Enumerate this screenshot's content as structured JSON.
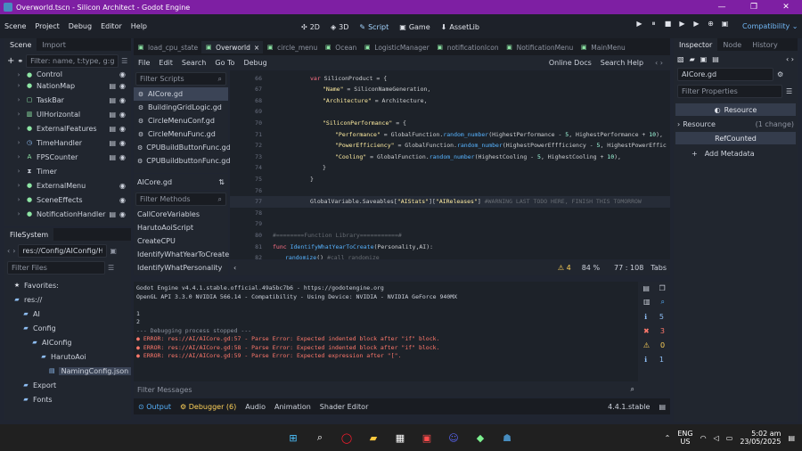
{
  "title": {
    "text": "Overworld.tscn - Silicon Architect - Godot Engine",
    "controls": [
      "—",
      "❐",
      "✕"
    ]
  },
  "menu": [
    "Scene",
    "Project",
    "Debug",
    "Editor",
    "Help"
  ],
  "workspaces": [
    {
      "icon": "✣",
      "label": "2D"
    },
    {
      "icon": "◈",
      "label": "3D"
    },
    {
      "icon": "✎",
      "label": "Script"
    },
    {
      "icon": "▣",
      "label": "Game"
    },
    {
      "icon": "⬇",
      "label": "AssetLib"
    }
  ],
  "play_icons": [
    "▶",
    "⏸",
    "■",
    "▶",
    "▶",
    "⊕",
    "▣"
  ],
  "renderer": "Compatibility ⌄",
  "scene_tabs": [
    "Scene",
    "Import"
  ],
  "scene_filter_placeholder": "Filter: name, t:type, g:gr",
  "scene_nodes": [
    {
      "label": "Control",
      "icon": "●",
      "color": "c-green",
      "vis": true,
      "script": false,
      "cut": true
    },
    {
      "label": "NationMap",
      "icon": "●",
      "color": "c-green",
      "vis": true,
      "script": true
    },
    {
      "label": "TaskBar",
      "icon": "▢",
      "color": "c-green",
      "vis": true,
      "script": true
    },
    {
      "label": "UIHorizontal",
      "icon": "▥",
      "color": "c-green",
      "vis": true,
      "script": true
    },
    {
      "label": "ExternalFeatures",
      "icon": "●",
      "color": "c-green",
      "vis": true,
      "script": true
    },
    {
      "label": "TimeHandler",
      "icon": "◷",
      "color": "c-blue",
      "vis": true,
      "script": true
    },
    {
      "label": "FPSCounter",
      "icon": "A",
      "color": "c-green",
      "vis": true,
      "script": true
    },
    {
      "label": "Timer",
      "icon": "⧗",
      "color": "",
      "vis": false,
      "script": false
    },
    {
      "label": "ExternalMenu",
      "icon": "●",
      "color": "c-green",
      "vis": true,
      "script": false
    },
    {
      "label": "SceneEffects",
      "icon": "●",
      "color": "c-green",
      "vis": true,
      "script": false
    },
    {
      "label": "NotificationHandler",
      "icon": "●",
      "color": "c-green",
      "vis": true,
      "script": true
    }
  ],
  "filesystem": {
    "tab": "FileSystem",
    "path": "res://Config/AIConfig/Haru",
    "filter_placeholder": "Filter Files",
    "items": [
      {
        "label": "Favorites:",
        "icon": "★",
        "indent": 0
      },
      {
        "label": "res://",
        "icon": "▰",
        "indent": 0
      },
      {
        "label": "AI",
        "icon": "▰",
        "indent": 1
      },
      {
        "label": "Config",
        "icon": "▰",
        "indent": 1
      },
      {
        "label": "AIConfig",
        "icon": "▰",
        "indent": 2
      },
      {
        "label": "HarutoAoi",
        "icon": "▰",
        "indent": 3
      },
      {
        "label": "NamingConfig.json",
        "icon": "▤",
        "indent": 4,
        "sel": true
      },
      {
        "label": "Export",
        "icon": "▰",
        "indent": 1
      },
      {
        "label": "Fonts",
        "icon": "▰",
        "indent": 1
      }
    ]
  },
  "script_tabs": [
    "load_cpu_state",
    "Overworld",
    "circle_menu",
    "Ocean",
    "LogisticManager",
    "notificationIcon",
    "NotificationMenu",
    "MainMenu"
  ],
  "script_menu": [
    "File",
    "Edit",
    "Search",
    "Go To",
    "Debug"
  ],
  "online_docs": "Online Docs",
  "search_help": "Search Help",
  "filter_scripts_placeholder": "Filter Scripts",
  "scripts": [
    {
      "label": "AICore.gd",
      "sel": true
    },
    {
      "label": "BuildingGridLogic.gd"
    },
    {
      "label": "CircleMenuConf.gd"
    },
    {
      "label": "CircleMenuFunc.gd"
    },
    {
      "label": "CPUBuildButtonFunc.gd"
    },
    {
      "label": "CPUBuildbuttonFunc.gd"
    }
  ],
  "current_script": "AICore.gd",
  "filter_methods_placeholder": "Filter Methods",
  "methods": [
    "CallCoreVariables",
    "HarutoAoiScript",
    "CreateCPU",
    "IdentifyWhatYearToCreate",
    "IdentifyWhatPersonality"
  ],
  "code": [
    {
      "n": "66",
      "t": "var SiliconProduct = {"
    },
    {
      "n": "67",
      "t": "\"Name\" = SiliconNameGeneration,"
    },
    {
      "n": "68",
      "t": "\"Architecture\" = Architecture,"
    },
    {
      "n": "69",
      "t": ""
    },
    {
      "n": "70",
      "t": "\"SiliconPerformance\" = {"
    },
    {
      "n": "71",
      "t": "\"Performance\" = GlobalFunction.random_number(HighestPerformance - 5, HighestPerformance + 10),"
    },
    {
      "n": "72",
      "t": "\"PowerEfficiency\" = GlobalFunction.random_number(HighestPowerEffficiency - 5, HighestPowerEffic"
    },
    {
      "n": "73",
      "t": "\"Cooling\" = GlobalFunction.random_number(HighestCooling - 5, HighestCooling + 10),"
    },
    {
      "n": "74",
      "t": "}"
    },
    {
      "n": "75",
      "t": "}"
    },
    {
      "n": "76",
      "t": ""
    },
    {
      "n": "77",
      "t": "GlobalVariable.Saveables[\"AIStats\"][\"AIReleases\"] #WARNING LAST TODO HERE, FINISH THIS TOMORROW"
    },
    {
      "n": "78",
      "t": ""
    },
    {
      "n": "79",
      "t": ""
    },
    {
      "n": "80",
      "t": "#========Function Library===========#"
    },
    {
      "n": "81",
      "t": "func IdentifyWhatYearToCreate(Personality,AI):"
    },
    {
      "n": "82",
      "t": "randomize() #call randomize"
    }
  ],
  "status": {
    "warnings": "⚠ 4",
    "zoom": "84 %",
    "position": "77 : 108",
    "indent": "Tabs"
  },
  "output": [
    "Godot Engine v4.4.1.stable.official.49a5bc7b6 - https://godotengine.org",
    "OpenGL API 3.3.0 NVIDIA 566.14 - Compatibility - Using Device: NVIDIA - NVIDIA GeForce 940MX",
    "",
    "1",
    "2",
    "--- Debugging process stopped ---",
    "ERROR: res://AI/AICore.gd:57 - Parse Error: Expected indented block after \"if\" block.",
    "ERROR: res://AI/AICore.gd:58 - Parse Error: Expected indented block after \"if\" block.",
    "ERROR: res://AI/AICore.gd:59 - Parse Error: Expected expression after \"[\"."
  ],
  "output_counts": [
    "5",
    "3",
    "0",
    "1"
  ],
  "filter_messages_placeholder": "Filter Messages",
  "bottom_tabs": [
    "Output",
    "Debugger (6)",
    "Audio",
    "Animation",
    "Shader Editor"
  ],
  "version": "4.4.1.stable",
  "inspector": {
    "tabs": [
      "Inspector",
      "Node",
      "History"
    ],
    "file": "AICore.gd",
    "filter_placeholder": "Filter Properties",
    "resource_header": "Resource",
    "resource_row": "Resource",
    "resource_change": "(1 change)",
    "refcounted": "RefCounted",
    "add_metadata": "Add Metadata"
  },
  "taskbar": {
    "lang": "ENG",
    "region": "US",
    "time": "5:02 am",
    "date": "23/05/2025"
  }
}
